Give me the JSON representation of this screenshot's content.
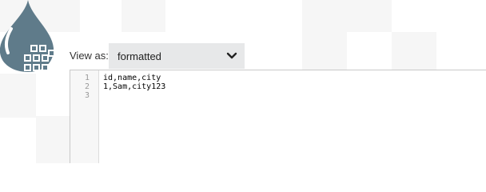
{
  "toolbar": {
    "view_as_label": "View as:",
    "view_mode_value": "formatted"
  },
  "editor": {
    "line_numbers": [
      "1",
      "2",
      "3"
    ],
    "lines": [
      "id,name,city",
      "1,Sam,city123",
      ""
    ]
  },
  "icons": {
    "logo": "water-drop-logo-icon",
    "chevron": "chevron-down-icon"
  },
  "colors": {
    "logo": "#5f7b8a",
    "select_bg": "#e7e8e9",
    "tile": "#f6f6f6",
    "gutter_bg": "#f7f7f7"
  }
}
